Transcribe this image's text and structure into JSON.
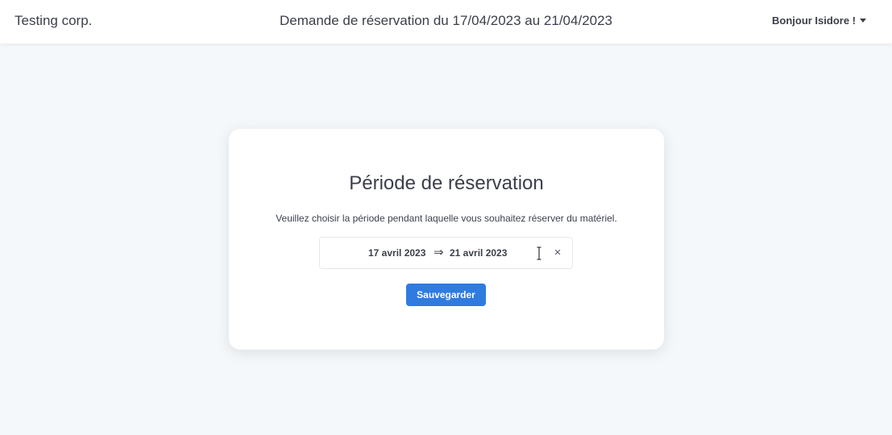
{
  "navbar": {
    "brand": "Testing corp.",
    "title": "Demande de réservation du 17/04/2023 au 21/04/2023",
    "user_greeting": "Bonjour Isidore !"
  },
  "card": {
    "title": "Période de réservation",
    "description": "Veuillez choisir la période pendant laquelle vous souhaitez réserver du matériel.",
    "date_range": {
      "start": "17 avril 2023",
      "separator": "⇒",
      "end": "21 avril 2023",
      "clear_symbol": "×"
    },
    "save_label": "Sauvegarder"
  },
  "colors": {
    "page_background": "#f5f8fb",
    "accent": "#2f7be0",
    "text": "#3b3f4a"
  },
  "icons": {
    "user_menu": "chevron-down-icon",
    "clear": "close-icon",
    "cursor": "text-cursor-icon"
  }
}
